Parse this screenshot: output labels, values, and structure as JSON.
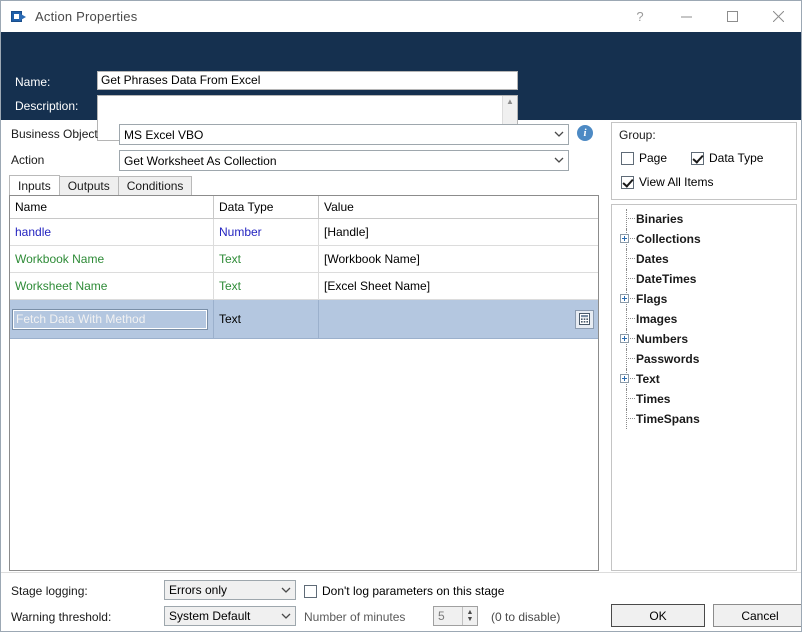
{
  "window": {
    "title": "Action Properties",
    "icon": "action-stage-icon",
    "controls": {
      "help": "?",
      "minimize": "minimize-icon",
      "maximize": "maximize-icon",
      "close": "close-icon"
    }
  },
  "header": {
    "name_label": "Name:",
    "name_value": "Get Phrases Data From Excel",
    "description_label": "Description:",
    "description_value": "",
    "accent_color": "#15304f"
  },
  "fields": {
    "business_object_label": "Business Object",
    "business_object_value": "MS Excel VBO",
    "action_label": "Action",
    "action_value": "Get Worksheet As Collection",
    "info_icon": "i"
  },
  "tabs": [
    {
      "label": "Inputs",
      "active": true
    },
    {
      "label": "Outputs",
      "active": false
    },
    {
      "label": "Conditions",
      "active": false
    }
  ],
  "grid": {
    "columns": [
      "Name",
      "Data Type",
      "Value"
    ],
    "rows": [
      {
        "name": "handle",
        "type": "Number",
        "value": "[Handle]",
        "name_color": "blue",
        "type_color": "blue",
        "selected": false,
        "editing": false
      },
      {
        "name": "Workbook Name",
        "type": "Text",
        "value": "[Workbook Name]",
        "name_color": "green",
        "type_color": "green",
        "selected": false,
        "editing": false
      },
      {
        "name": "Worksheet Name",
        "type": "Text",
        "value": "[Excel Sheet Name]",
        "name_color": "green",
        "type_color": "green",
        "selected": false,
        "editing": false
      },
      {
        "name": "Fetch Data With Method",
        "type": "Text",
        "value": "",
        "name_color": "white",
        "type_color": "black",
        "selected": true,
        "editing": true
      }
    ]
  },
  "group_panel": {
    "title": "Group:",
    "checkboxes": [
      {
        "label": "Page",
        "checked": false
      },
      {
        "label": "Data Type",
        "checked": true
      },
      {
        "label": "View All Items",
        "checked": true
      }
    ]
  },
  "tree": {
    "items": [
      {
        "label": "Binaries",
        "expandable": false
      },
      {
        "label": "Collections",
        "expandable": true
      },
      {
        "label": "Dates",
        "expandable": false
      },
      {
        "label": "DateTimes",
        "expandable": false
      },
      {
        "label": "Flags",
        "expandable": true
      },
      {
        "label": "Images",
        "expandable": false
      },
      {
        "label": "Numbers",
        "expandable": true
      },
      {
        "label": "Passwords",
        "expandable": false
      },
      {
        "label": "Text",
        "expandable": true
      },
      {
        "label": "Times",
        "expandable": false
      },
      {
        "label": "TimeSpans",
        "expandable": false
      }
    ]
  },
  "footer": {
    "stage_logging_label": "Stage logging:",
    "stage_logging_value": "Errors only",
    "dont_log_label": "Don't log parameters on this stage",
    "dont_log_checked": false,
    "warning_threshold_label": "Warning threshold:",
    "warning_threshold_value": "System Default",
    "minutes_label": "Number of minutes",
    "minutes_value": "5",
    "disable_hint": "(0 to disable)",
    "ok_label": "OK",
    "cancel_label": "Cancel"
  }
}
